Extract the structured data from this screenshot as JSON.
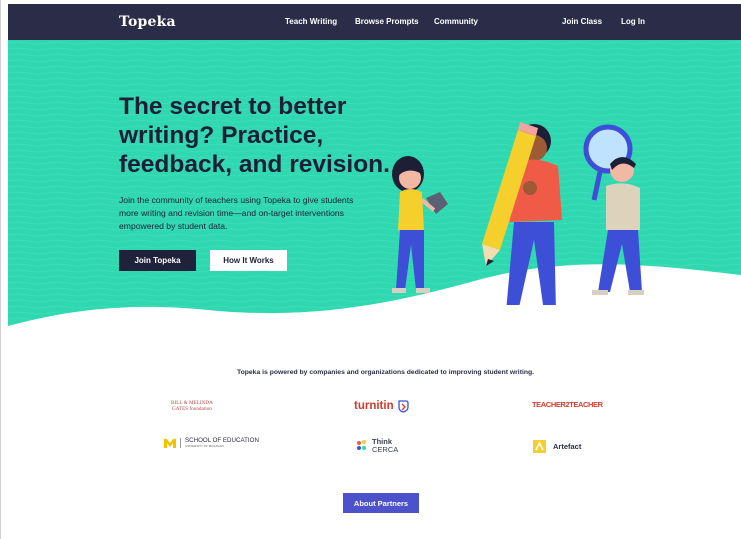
{
  "nav": {
    "brand": "Topeka",
    "links": [
      "Teach Writing",
      "Browse Prompts",
      "Community"
    ],
    "right_links": [
      "Join Class",
      "Log In"
    ]
  },
  "hero": {
    "headline": "The secret to better writing? Practice, feedback, and revision.",
    "subtext": "Join the community of teachers using Topeka to give students more writing and revision time—and on-target interventions empowered by student data.",
    "primary_button": "Join Topeka",
    "secondary_button": "How It Works"
  },
  "partners": {
    "title": "Topeka is powered by companies and organizations dedicated to improving student writing.",
    "gates_line1": "BILL & MELINDA",
    "gates_line2": "GATES foundation",
    "turnitin": "turnitin",
    "teacher2teacher": "TEACHER2TEACHER",
    "michigan": "SCHOOL OF EDUCATION",
    "michigan_sub": "UNIVERSITY OF MICHIGAN",
    "think": "Think",
    "cerca": "CERCA",
    "artefact": "Artefact",
    "button": "About Partners"
  },
  "colors": {
    "nav": "#2b2d48",
    "hero": "#2fd8b0",
    "primary": "#20213a",
    "accent": "#4c52c9"
  }
}
